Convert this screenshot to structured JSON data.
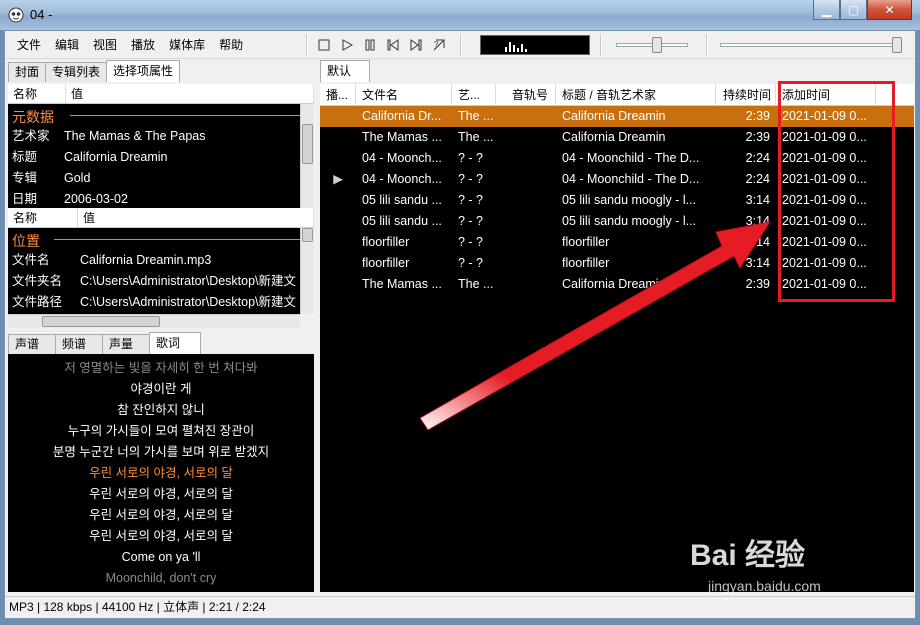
{
  "window": {
    "title": "04 -"
  },
  "menu": [
    "文件",
    "编辑",
    "视图",
    "播放",
    "媒体库",
    "帮助"
  ],
  "left_tabs": [
    "封面",
    "专辑列表",
    "选择项属性"
  ],
  "props": {
    "headers": [
      "名称",
      "值"
    ],
    "section_meta": "元数据",
    "meta_rows": [
      {
        "k": "艺术家",
        "v": "The Mamas & The Papas"
      },
      {
        "k": "标题",
        "v": "California Dreamin"
      },
      {
        "k": "专辑",
        "v": "Gold"
      },
      {
        "k": "日期",
        "v": "2006-03-02"
      }
    ],
    "section_location": "位置",
    "location_rows": [
      {
        "k": "文件名",
        "v": "California Dreamin.mp3"
      },
      {
        "k": "文件夹名",
        "v": "C:\\Users\\Administrator\\Desktop\\新建文"
      },
      {
        "k": "文件路径",
        "v": "C:\\Users\\Administrator\\Desktop\\新建文"
      }
    ]
  },
  "lyric_tabs": [
    "声谱",
    "频谱",
    "声量计",
    "歌词"
  ],
  "lyrics": [
    {
      "text": "저 영멸하는 빛을 자세히 한 번 쳐다봐",
      "state": "dim"
    },
    {
      "text": "야경이란 게",
      "state": "normal"
    },
    {
      "text": "참 잔인하지 않니",
      "state": "normal"
    },
    {
      "text": "누구의 가시들이 모여 펼쳐진 장관이",
      "state": "normal"
    },
    {
      "text": "분명 누군간 너의 가시를 보며 위로 받겠지",
      "state": "normal"
    },
    {
      "text": "우린 서로의 야경, 서로의 달",
      "state": "current"
    },
    {
      "text": "우린 서로의 야경, 서로의 달",
      "state": "normal"
    },
    {
      "text": "우린 서로의 야경, 서로의 달",
      "state": "normal"
    },
    {
      "text": "우린 서로의 야경, 서로의 달",
      "state": "normal"
    },
    {
      "text": "Come on ya 'll",
      "state": "normal"
    },
    {
      "text": "Moonchild, don't cry",
      "state": "dim"
    }
  ],
  "playlist_tabs": [
    "默认"
  ],
  "playlist": {
    "headers": [
      "播...",
      "文件名",
      "艺...",
      "音轨号",
      "标题 / 音轨艺术家",
      "持续时间",
      "添加时间"
    ],
    "rows": [
      {
        "playing": "",
        "file": "California Dr...",
        "artist": "The ...",
        "track": "",
        "title": "California Dreamin",
        "dur": "2:39",
        "added": "2021-01-09 0...",
        "selected": true
      },
      {
        "playing": "",
        "file": "The Mamas ...",
        "artist": "The ...",
        "track": "",
        "title": "California Dreamin",
        "dur": "2:39",
        "added": "2021-01-09 0...",
        "selected": false
      },
      {
        "playing": "",
        "file": "04 - Moonch...",
        "artist": "? - ?",
        "track": "",
        "title": "04 - Moonchild - The D...",
        "dur": "2:24",
        "added": "2021-01-09 0...",
        "selected": false
      },
      {
        "playing": "▶",
        "file": "04 - Moonch...",
        "artist": "? - ?",
        "track": "",
        "title": "04 - Moonchild - The D...",
        "dur": "2:24",
        "added": "2021-01-09 0...",
        "selected": false
      },
      {
        "playing": "",
        "file": "05 lili sandu ...",
        "artist": "? - ?",
        "track": "",
        "title": "05 lili sandu moogly - l...",
        "dur": "3:14",
        "added": "2021-01-09 0...",
        "selected": false
      },
      {
        "playing": "",
        "file": "05 lili sandu ...",
        "artist": "? - ?",
        "track": "",
        "title": "05 lili sandu moogly - l...",
        "dur": "3:14",
        "added": "2021-01-09 0...",
        "selected": false
      },
      {
        "playing": "",
        "file": "floorfiller",
        "artist": "? - ?",
        "track": "",
        "title": "floorfiller",
        "dur": "3:14",
        "added": "2021-01-09 0...",
        "selected": false
      },
      {
        "playing": "",
        "file": "floorfiller",
        "artist": "? - ?",
        "track": "",
        "title": "floorfiller",
        "dur": "3:14",
        "added": "2021-01-09 0...",
        "selected": false
      },
      {
        "playing": "",
        "file": "The Mamas ...",
        "artist": "The ...",
        "track": "",
        "title": "California Dreamin",
        "dur": "2:39",
        "added": "2021-01-09 0...",
        "selected": false
      }
    ]
  },
  "status": "MP3 | 128 kbps | 44100 Hz | 立体声 | 2:21 / 2:24",
  "watermark": {
    "brand": "Bai 经验",
    "url": "jingyan.baidu.com"
  },
  "colors": {
    "selection": "#c8700f",
    "accent_orange": "#ff8a3c",
    "annotation_red": "#e51c24"
  },
  "volume_level": 0.55,
  "seek_progress": 0.98
}
